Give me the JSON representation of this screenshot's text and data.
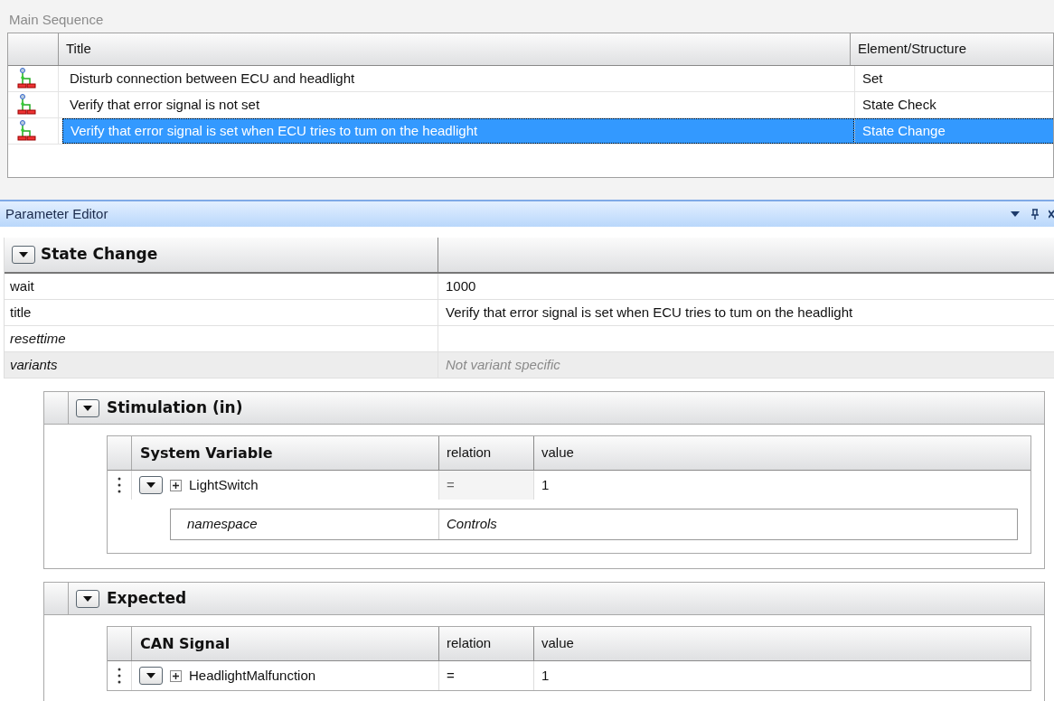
{
  "main_sequence": {
    "title": "Main Sequence",
    "columns": [
      "Title",
      "Element/Structure"
    ],
    "rows": [
      {
        "title": "Disturb connection between ECU and headlight",
        "element": "Set",
        "selected": false
      },
      {
        "title": "Verify that error signal is not set",
        "element": "State Check",
        "selected": false
      },
      {
        "title": "Verify that error signal is set when ECU tries to tum on the headlight",
        "element": "State Change",
        "selected": true
      }
    ]
  },
  "parameter_editor": {
    "title": "Parameter Editor",
    "group": {
      "title": "State Change",
      "properties": [
        {
          "name": "wait",
          "value": "1000",
          "kind": "required",
          "inherited": false
        },
        {
          "name": "title",
          "value": "Verify that error signal is set when ECU tries to tum on the headlight",
          "kind": "required",
          "inherited": false
        },
        {
          "name": "resettime",
          "kind": "optional",
          "inherited": false
        },
        {
          "name": "variants",
          "value": "Not variant specific",
          "kind": "optional",
          "inherited": true
        }
      ]
    },
    "sections": [
      {
        "title": "Stimulation (in)",
        "columns": [
          "System Variable",
          "relation",
          "value"
        ],
        "rows": [
          {
            "name": "LightSwitch",
            "relation": "=",
            "value": "1",
            "relation_dim": true,
            "details": [
              {
                "name": "namespace",
                "value": "Controls"
              }
            ]
          }
        ]
      },
      {
        "title": "Expected",
        "columns": [
          "CAN Signal",
          "relation",
          "value"
        ],
        "rows": [
          {
            "name": "HeadlightMalfunction",
            "relation": "=",
            "value": "1",
            "relation_dim": false
          }
        ]
      }
    ]
  }
}
